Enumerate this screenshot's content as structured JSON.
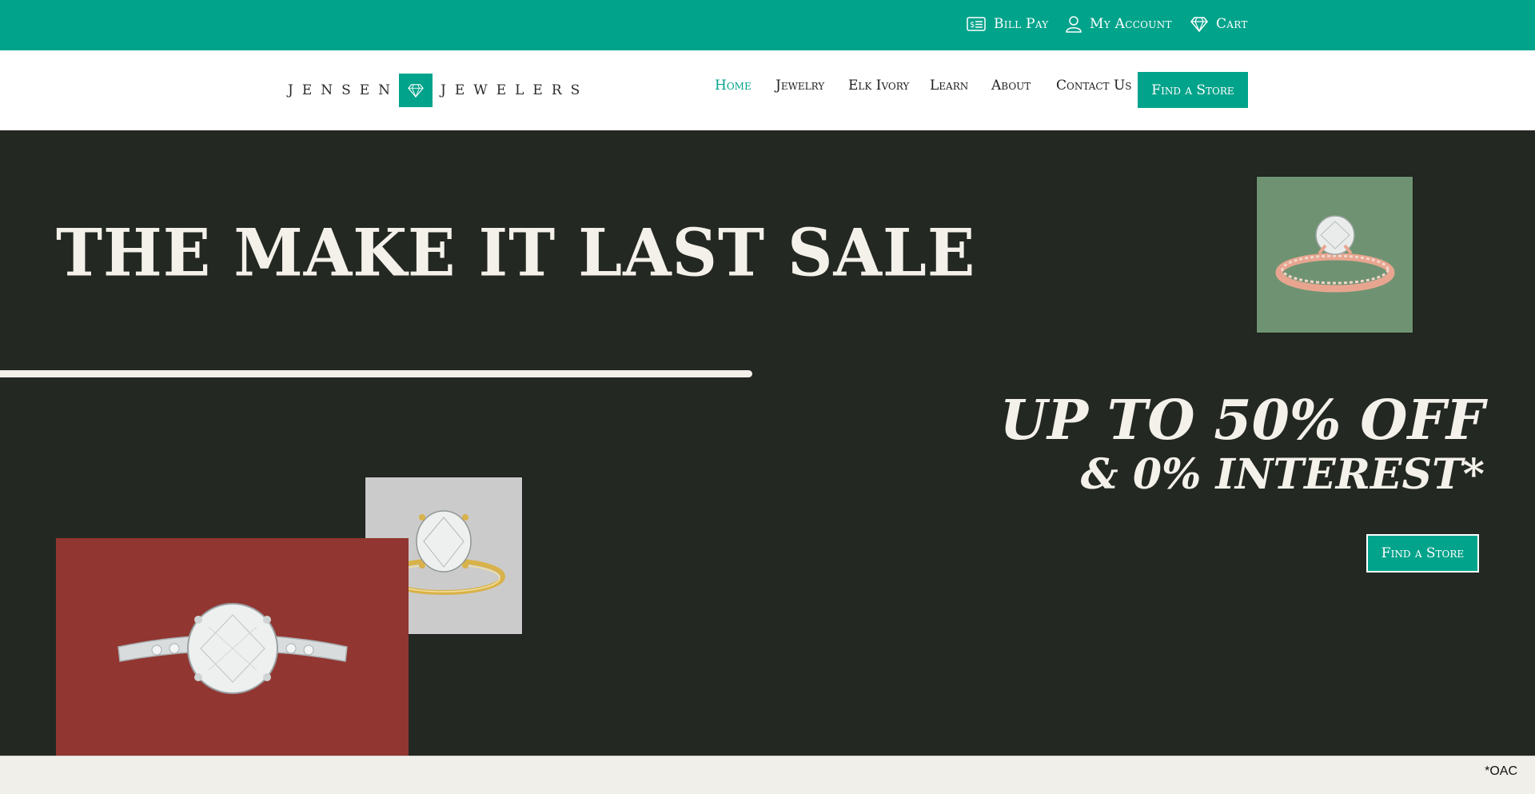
{
  "topbar": {
    "bill_pay": "Bill Pay",
    "my_account": "My Account",
    "cart": "Cart"
  },
  "header": {
    "logo_left": "JENSEN",
    "logo_right": "JEWELERS",
    "nav": {
      "home": "Home",
      "jewelry": "Jewelry",
      "elk_ivory": "Elk Ivory",
      "learn": "Learn",
      "about": "About",
      "contact": "Contact Us"
    },
    "cta": "Find a Store"
  },
  "hero": {
    "headline": "THE MAKE IT LAST SALE",
    "offer_line1": "UP TO 50% OFF",
    "offer_line2": "& 0% INTEREST*",
    "cta": "Find a Store"
  },
  "footer": {
    "note": "*OAC"
  },
  "colors": {
    "brand_teal": "#02a38b",
    "hero_bg": "#242822",
    "cream": "#f3f1ea",
    "tile_green": "#6f9372",
    "tile_gray": "#cbcbcb",
    "tile_red": "#913631"
  }
}
